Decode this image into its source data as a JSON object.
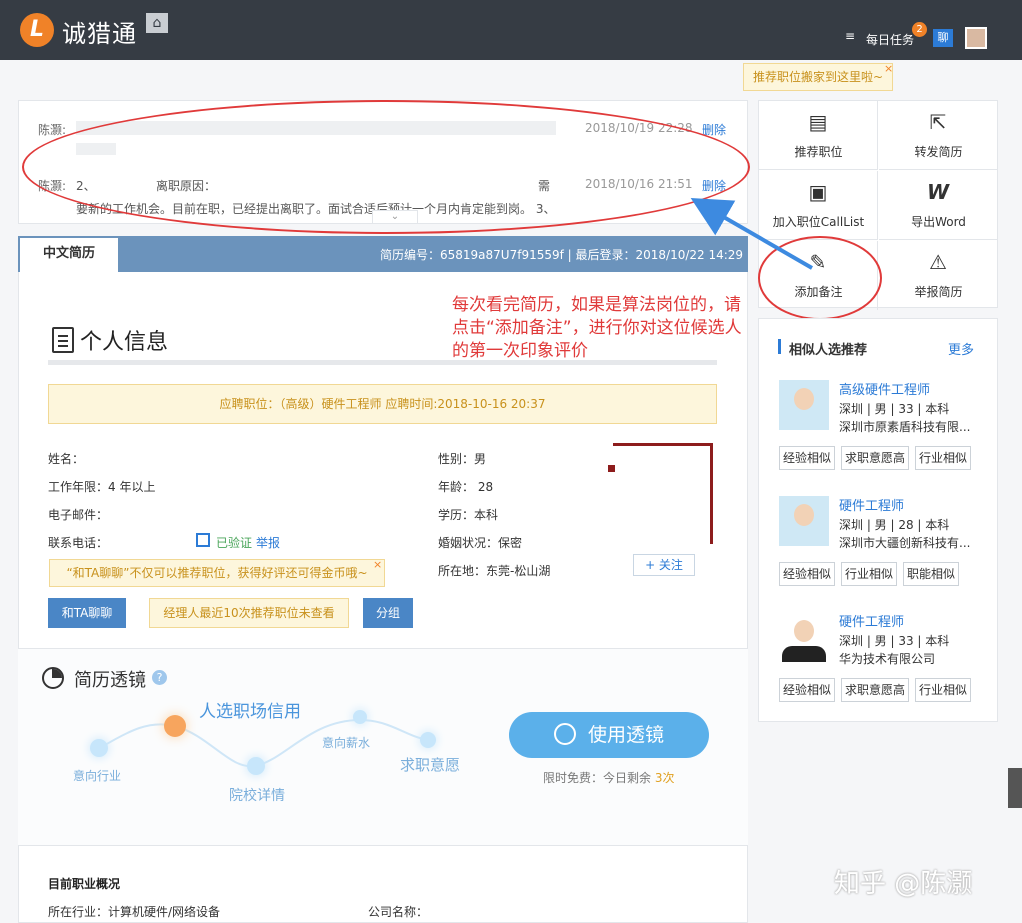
{
  "header": {
    "logo_letter": "L",
    "brand": "诚猎通",
    "home_glyph": "⌂",
    "task_glyph": "≡",
    "daily_task_label": "每日任务",
    "task_count": "2",
    "chat_label": "聊"
  },
  "move_tip": {
    "text": "推荐职位搬家到这里啦~",
    "close": "×"
  },
  "notes": [
    {
      "author": "陈灏:",
      "body": "",
      "time": "2018/10/19 22:28",
      "delete": "删除"
    },
    {
      "author": "陈灏:",
      "body_prefix": "2、",
      "body_mid": "离职原因：",
      "body_end": "需",
      "body_line2": "要新的工作机会。目前在职，已经提出离职了。面试合适后预计一个月内肯定能到岗。 3、",
      "time": "2018/10/16 21:51",
      "delete": "删除"
    }
  ],
  "expand_glyph": "⌄",
  "resume": {
    "tab_label": "中文简历",
    "meta": "简历编号：65819a87U7f91559f | 最后登录：2018/10/22 14:29",
    "section_title": "个人信息",
    "apply_info": "应聘职位：（高级）硬件工程师 应聘时间:2018-10-16 20:37",
    "fields": {
      "name": "姓名：",
      "experience": "工作年限：4 年以上",
      "email": "电子邮件：",
      "phone": "联系电话：",
      "verified": "已验证",
      "report": "举报",
      "gender": "性别：男",
      "age": "年龄： 28",
      "education": "学历：本科",
      "marital": "婚姻状况：保密",
      "location": "所在地：东莞-松山湖"
    },
    "follow_button": "+ 关注",
    "chat_tip": "“和TA聊聊”不仅可以推荐职位，获得好评还可得金币哦~",
    "chat_tip_close": "×",
    "chat_button": "和TA聊聊",
    "unviewed_notice": "经理人最近10次推荐职位未查看",
    "group_button": "分组"
  },
  "annotation": "每次看完简历，如果是算法岗位的，请点击“添加备注”，进行你对这位候选人的第一次印象评价",
  "lens": {
    "title": "简历透镜",
    "help": "?",
    "main_label": "人选职场信用",
    "labels": [
      "意向行业",
      "院校详情",
      "意向薪水",
      "求职意愿"
    ],
    "button": "使用透镜",
    "free_prefix": "限时免费：今日剩余 ",
    "free_count": "3次"
  },
  "career": {
    "title": "目前职业概况",
    "industry": "所在行业：计算机硬件/网络设备",
    "company": "公司名称："
  },
  "actions": [
    {
      "label": "推荐职位",
      "icon": "recommend-doc-icon",
      "glyph": "▤"
    },
    {
      "label": "转发简历",
      "icon": "forward-icon",
      "glyph": "⇱"
    },
    {
      "label": "加入职位CallList",
      "icon": "briefcase-icon",
      "glyph": "▣"
    },
    {
      "label": "导出Word",
      "icon": "word-icon",
      "glyph": "W"
    },
    {
      "label": "添加备注",
      "icon": "edit-note-icon",
      "glyph": "✎"
    },
    {
      "label": "举报简历",
      "icon": "shield-icon",
      "glyph": "⚠"
    }
  ],
  "similar": {
    "title": "相似人选推荐",
    "more": "更多",
    "candidates": [
      {
        "title": "高级硬件工程师",
        "info": "深圳 | 男 | 33 | 本科",
        "company": "深圳市原素盾科技有限...",
        "tags": [
          "经验相似",
          "求职意愿高",
          "行业相似"
        ]
      },
      {
        "title": "硬件工程师",
        "info": "深圳 | 男 | 28 | 本科",
        "company": "深圳市大疆创新科技有...",
        "tags": [
          "经验相似",
          "行业相似",
          "职能相似"
        ]
      },
      {
        "title": "硬件工程师",
        "info": "深圳 | 男 | 33 | 本科",
        "company": "华为技术有限公司",
        "tags": [
          "经验相似",
          "求职意愿高",
          "行业相似"
        ]
      }
    ]
  },
  "watermark": "知乎 @陈灏",
  "colors": {
    "header_bg": "#363c44",
    "accent_orange": "#f08228",
    "link_blue": "#2c7bd6",
    "annotation_red": "#e03a3a",
    "resume_header": "#6b93bc"
  }
}
